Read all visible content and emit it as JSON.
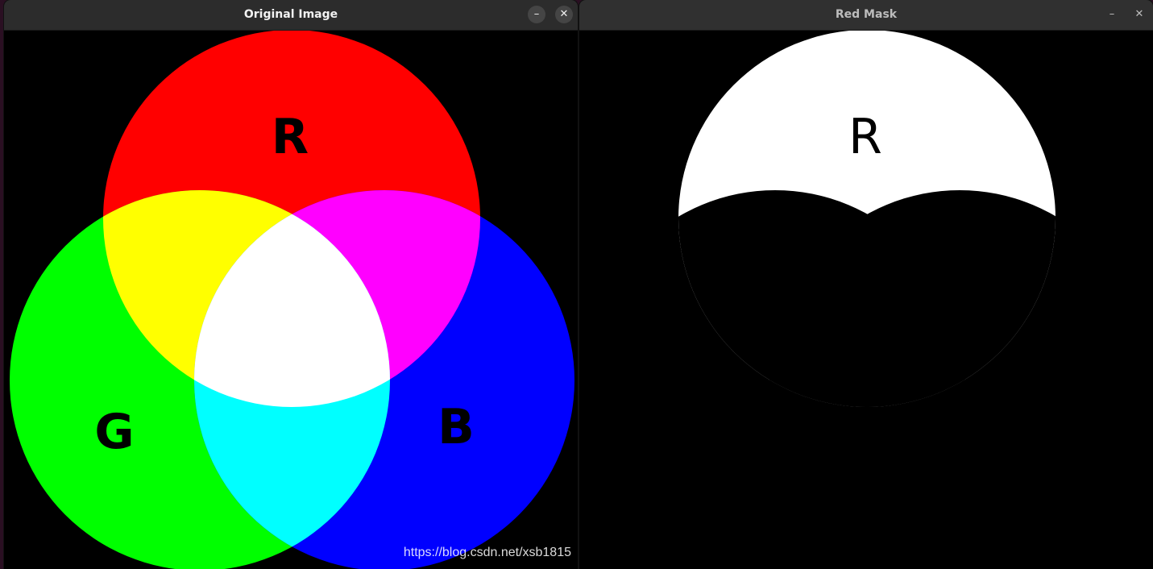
{
  "windows": {
    "original": {
      "title": "Original Image",
      "minimize_icon": "–",
      "close_icon": "✕",
      "labels": {
        "r": "R",
        "g": "G",
        "b": "B"
      },
      "watermark": "https://blog.csdn.net/xsb1815",
      "colors": {
        "red": "#ff0000",
        "green": "#00ff00",
        "blue": "#0000ff",
        "yellow": "#ffff00",
        "magenta": "#ff00ff",
        "cyan": "#00ffff",
        "white": "#ffffff"
      }
    },
    "mask": {
      "title": "Red Mask",
      "minimize_icon": "–",
      "close_icon": "✕",
      "label": "R"
    }
  }
}
